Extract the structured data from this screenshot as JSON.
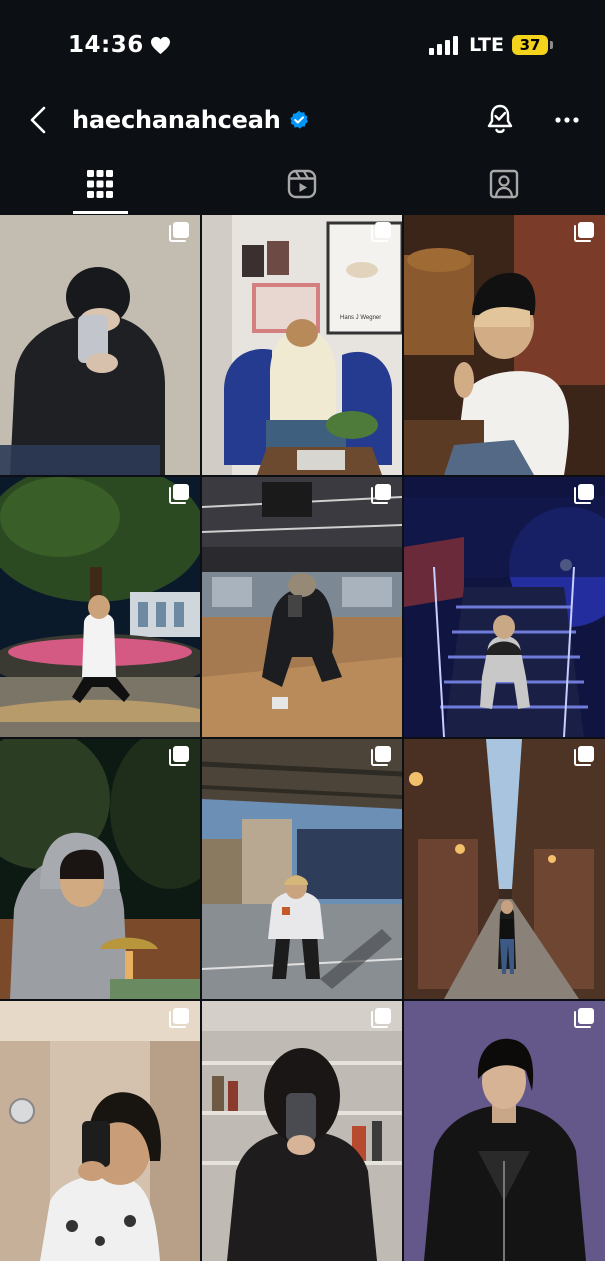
{
  "status_bar": {
    "time": "14:36",
    "network": "LTE",
    "battery": "37",
    "icons": [
      "heart-icon",
      "signal-icon",
      "battery-icon"
    ],
    "battery_color": "#f4d31c"
  },
  "header": {
    "username": "haechanahceah",
    "icons": [
      "back-icon",
      "verified-icon",
      "bell-icon",
      "more-icon"
    ],
    "verified_color": "#0095f6"
  },
  "tabs": [
    {
      "icon": "grid-icon",
      "selected": true
    },
    {
      "icon": "reels-icon",
      "selected": false
    },
    {
      "icon": "tagged-icon",
      "selected": false
    }
  ],
  "posts": [
    {
      "icon": "multi-image-icon"
    },
    {
      "icon": "multi-image-icon",
      "poster_text": "Hans J Wegner"
    },
    {
      "icon": "multi-image-icon"
    },
    {
      "icon": "multi-image-icon"
    },
    {
      "icon": "multi-image-icon"
    },
    {
      "icon": "multi-image-icon"
    },
    {
      "icon": "multi-image-icon"
    },
    {
      "icon": "multi-image-icon"
    },
    {
      "icon": "multi-image-icon"
    },
    {
      "icon": "multi-image-icon"
    },
    {
      "icon": "multi-image-icon"
    },
    {
      "icon": "multi-image-icon"
    }
  ]
}
